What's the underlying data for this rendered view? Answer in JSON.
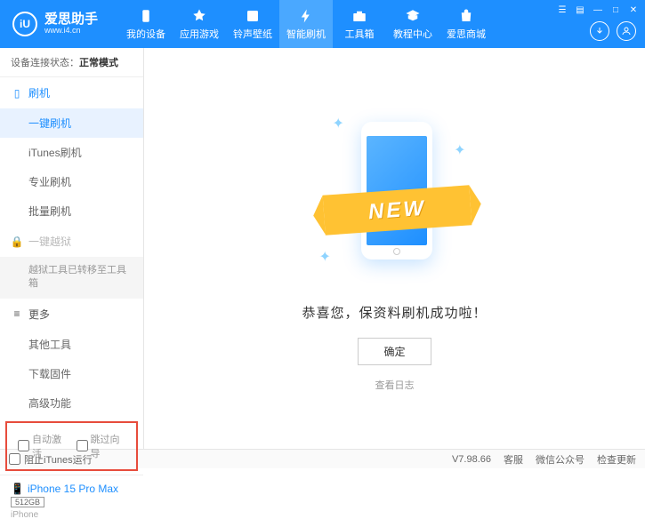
{
  "logo": {
    "icon": "iU",
    "title": "爱思助手",
    "subtitle": "www.i4.cn"
  },
  "nav": [
    {
      "label": "我的设备"
    },
    {
      "label": "应用游戏"
    },
    {
      "label": "铃声壁纸"
    },
    {
      "label": "智能刷机"
    },
    {
      "label": "工具箱"
    },
    {
      "label": "教程中心"
    },
    {
      "label": "爱思商城"
    }
  ],
  "status": {
    "label": "设备连接状态：",
    "value": "正常模式"
  },
  "sidebar": {
    "flash": {
      "header": "刷机",
      "items": [
        "一键刷机",
        "iTunes刷机",
        "专业刷机",
        "批量刷机"
      ]
    },
    "jailbreak": {
      "header": "一键越狱",
      "note": "越狱工具已转移至工具箱"
    },
    "more": {
      "header": "更多",
      "items": [
        "其他工具",
        "下载固件",
        "高级功能"
      ]
    }
  },
  "checkboxes": {
    "auto_activate": "自动激活",
    "skip_guide": "跳过向导"
  },
  "device": {
    "name": "iPhone 15 Pro Max",
    "storage": "512GB",
    "type": "iPhone"
  },
  "main": {
    "ribbon": "NEW",
    "message": "恭喜您，保资料刷机成功啦！",
    "ok": "确定",
    "log": "查看日志"
  },
  "footer": {
    "block_itunes": "阻止iTunes运行",
    "version": "V7.98.66",
    "links": [
      "客服",
      "微信公众号",
      "检查更新"
    ]
  }
}
